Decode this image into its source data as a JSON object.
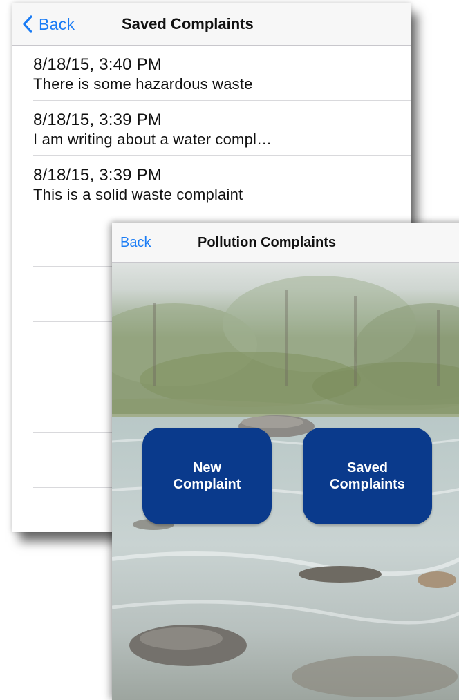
{
  "saved_screen": {
    "back_label": "Back",
    "title": "Saved Complaints",
    "items": [
      {
        "date": "8/18/15, 3:40 PM",
        "text": "There is some hazardous waste"
      },
      {
        "date": "8/18/15, 3:39 PM",
        "text": "I am writing about a water compl…"
      },
      {
        "date": "8/18/15, 3:39 PM",
        "text": "This is a solid waste complaint"
      }
    ]
  },
  "pollution_screen": {
    "back_label": "Back",
    "title": "Pollution Complaints",
    "buttons": {
      "new_line1": "New",
      "new_line2": "Complaint",
      "saved_line1": "Saved",
      "saved_line2": "Complaints"
    },
    "background": "river-photo"
  },
  "colors": {
    "ios_blue": "#1a7cf5",
    "tile_blue": "#0a3a8c",
    "nav_bg": "#f7f7f7"
  }
}
